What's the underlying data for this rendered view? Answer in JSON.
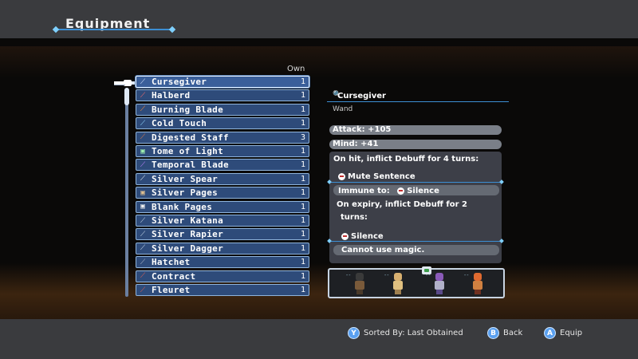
{
  "header": {
    "title": "Equipment"
  },
  "list": {
    "own_label": "Own",
    "items": [
      {
        "name": "Cursegiver",
        "qty": "1",
        "icon": "wand-icon",
        "color": "#d8e4ff"
      },
      {
        "name": "Halberd",
        "qty": "1",
        "icon": "polearm-icon",
        "color": "#ff6a6a"
      },
      {
        "name": "Burning Blade",
        "qty": "1",
        "icon": "sword-icon",
        "color": "#ff8a3c"
      },
      {
        "name": "Cold Touch",
        "qty": "1",
        "icon": "wand-icon",
        "color": "#8fd8ff"
      },
      {
        "name": "Digested Staff",
        "qty": "3",
        "icon": "staff-icon",
        "color": "#e07a4a"
      },
      {
        "name": "Tome of Light",
        "qty": "1",
        "icon": "tome-icon",
        "color": "#9ff0b0"
      },
      {
        "name": "Temporal Blade",
        "qty": "1",
        "icon": "sword-icon",
        "color": "#c080ff"
      },
      {
        "name": "Silver Spear",
        "qty": "1",
        "icon": "spear-icon",
        "color": "#dfe8f0"
      },
      {
        "name": "Silver Pages",
        "qty": "1",
        "icon": "tome-icon",
        "color": "#e0c090"
      },
      {
        "name": "Blank Pages",
        "qty": "1",
        "icon": "tome-icon",
        "color": "#f0f0f0"
      },
      {
        "name": "Silver Katana",
        "qty": "1",
        "icon": "sword-icon",
        "color": "#c8d8e8"
      },
      {
        "name": "Silver Rapier",
        "qty": "1",
        "icon": "sword-icon",
        "color": "#c8d8e8"
      },
      {
        "name": "Silver Dagger",
        "qty": "1",
        "icon": "dagger-icon",
        "color": "#c8d8e8"
      },
      {
        "name": "Hatchet",
        "qty": "1",
        "icon": "axe-icon",
        "color": "#b0b8c8"
      },
      {
        "name": "Contract",
        "qty": "1",
        "icon": "staff-icon",
        "color": "#e06050"
      },
      {
        "name": "Fleuret",
        "qty": "1",
        "icon": "sword-icon",
        "color": "#e06050"
      }
    ]
  },
  "detail": {
    "name": "Cursegiver",
    "type": "Wand",
    "attack": "Attack:  +105",
    "mind": "Mind:  +41",
    "on_hit": "On hit, inflict Debuff for 4 turns:",
    "debuff1": "Mute Sentence",
    "immune_label": "Immune to:",
    "immune_value": "Silence",
    "expiry_line1": "On expiry, inflict Debuff for 2",
    "expiry_line2": "turns:",
    "debuff2": "Silence",
    "debuff2_desc": "Cannot use magic."
  },
  "footer": {
    "sort": {
      "button": "Y",
      "label": "Sorted By: Last Obtained"
    },
    "back": {
      "button": "B",
      "label": "Back"
    },
    "equip": {
      "button": "A",
      "label": "Equip"
    }
  },
  "colors": {
    "accent": "#3c8fd4",
    "row_bg": "#2e4b7a",
    "row_border": "#8fb4dc"
  }
}
